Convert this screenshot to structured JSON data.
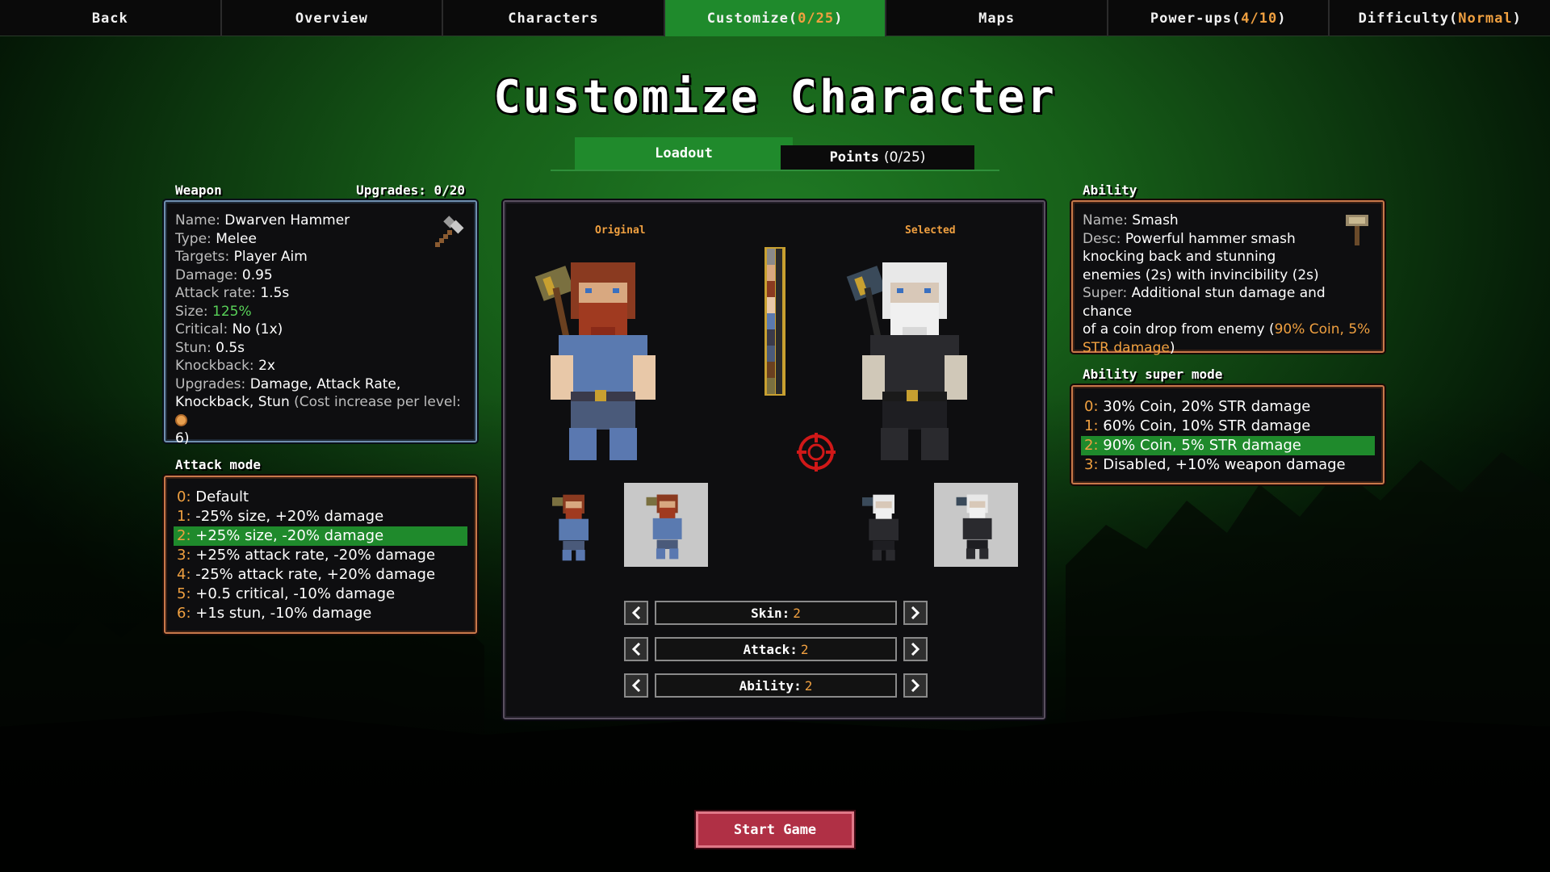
{
  "nav": {
    "tabs": [
      {
        "label": "Back"
      },
      {
        "label": "Overview"
      },
      {
        "label": "Characters"
      },
      {
        "label": "Customize",
        "suffix_pre": " (",
        "suffix": "0/25",
        "suffix_post": ")"
      },
      {
        "label": "Maps"
      },
      {
        "label": "Power-ups",
        "suffix_pre": " (",
        "suffix": "4/10",
        "suffix_post": ")"
      },
      {
        "label": "Difficulty",
        "suffix_pre": " (",
        "suffix": "Normal",
        "suffix_post": ")"
      }
    ],
    "active_index": 3
  },
  "page_title": "Customize Character",
  "subtabs": {
    "loadout": "Loadout",
    "points": "Points",
    "points_count": "(0/25)"
  },
  "weapon": {
    "heading": "Weapon",
    "upgrades": "Upgrades: 0/20",
    "name_k": "Name:",
    "name_v": "Dwarven Hammer",
    "type_k": "Type:",
    "type_v": "Melee",
    "targets_k": "Targets:",
    "targets_v": "Player Aim",
    "damage_k": "Damage:",
    "damage_v": "0.95",
    "rate_k": "Attack rate:",
    "rate_v": "1.5s",
    "size_k": "Size:",
    "size_v": "125%",
    "crit_k": "Critical:",
    "crit_v": "No (1x)",
    "stun_k": "Stun:",
    "stun_v": "0.5s",
    "knock_k": "Knockback:",
    "knock_v": "2x",
    "upg_k": "Upgrades:",
    "upg_v": "Damage, Attack Rate,",
    "upg_v2": "Knockback, Stun",
    "upg_cost": "(Cost increase per level:",
    "upg_cost_n": "6)"
  },
  "attack_mode": {
    "heading": "Attack mode",
    "items": [
      {
        "n": "0:",
        "t": "Default"
      },
      {
        "n": "1:",
        "t": "-25% size, +20% damage"
      },
      {
        "n": "2:",
        "t": "+25% size, -20% damage"
      },
      {
        "n": "3:",
        "t": "+25% attack rate, -20% damage"
      },
      {
        "n": "4:",
        "t": "-25% attack rate, +20% damage"
      },
      {
        "n": "5:",
        "t": "+0.5 critical, -10% damage"
      },
      {
        "n": "6:",
        "t": "+1s stun, -10% damage"
      }
    ],
    "selected": 2
  },
  "preview": {
    "original_label": "Original",
    "selected_label": "Selected",
    "skin_label": "Skin:",
    "skin_value": "2",
    "attack_label": "Attack:",
    "attack_value": "2",
    "ability_label": "Ability:",
    "ability_value": "2"
  },
  "ability": {
    "heading": "Ability",
    "name_k": "Name:",
    "name_v": "Smash",
    "desc_k": "Desc:",
    "desc_v1": "Powerful hammer smash",
    "desc_v2": "knocking back and stunning",
    "desc_v3": "enemies (2s) with invincibility (2s)",
    "super_k": "Super:",
    "super_v1": "Additional stun damage and chance",
    "super_v2": "of a coin drop from enemy (",
    "super_hl1": "90% Coin, 5%",
    "super_hl2": "STR damage",
    "super_close": ")"
  },
  "ability_super": {
    "heading": "Ability super mode",
    "items": [
      {
        "n": "0:",
        "t": "30% Coin, 20% STR damage"
      },
      {
        "n": "1:",
        "t": "60% Coin, 10% STR damage"
      },
      {
        "n": "2:",
        "t": "90% Coin, 5% STR damage"
      },
      {
        "n": "3:",
        "t": "Disabled, +10% weapon damage"
      }
    ],
    "selected": 2
  },
  "start_button": "Start Game",
  "colors": {
    "accent_green": "#1f8a2c",
    "accent_orange": "#f0a040",
    "start_red": "#b03045"
  }
}
